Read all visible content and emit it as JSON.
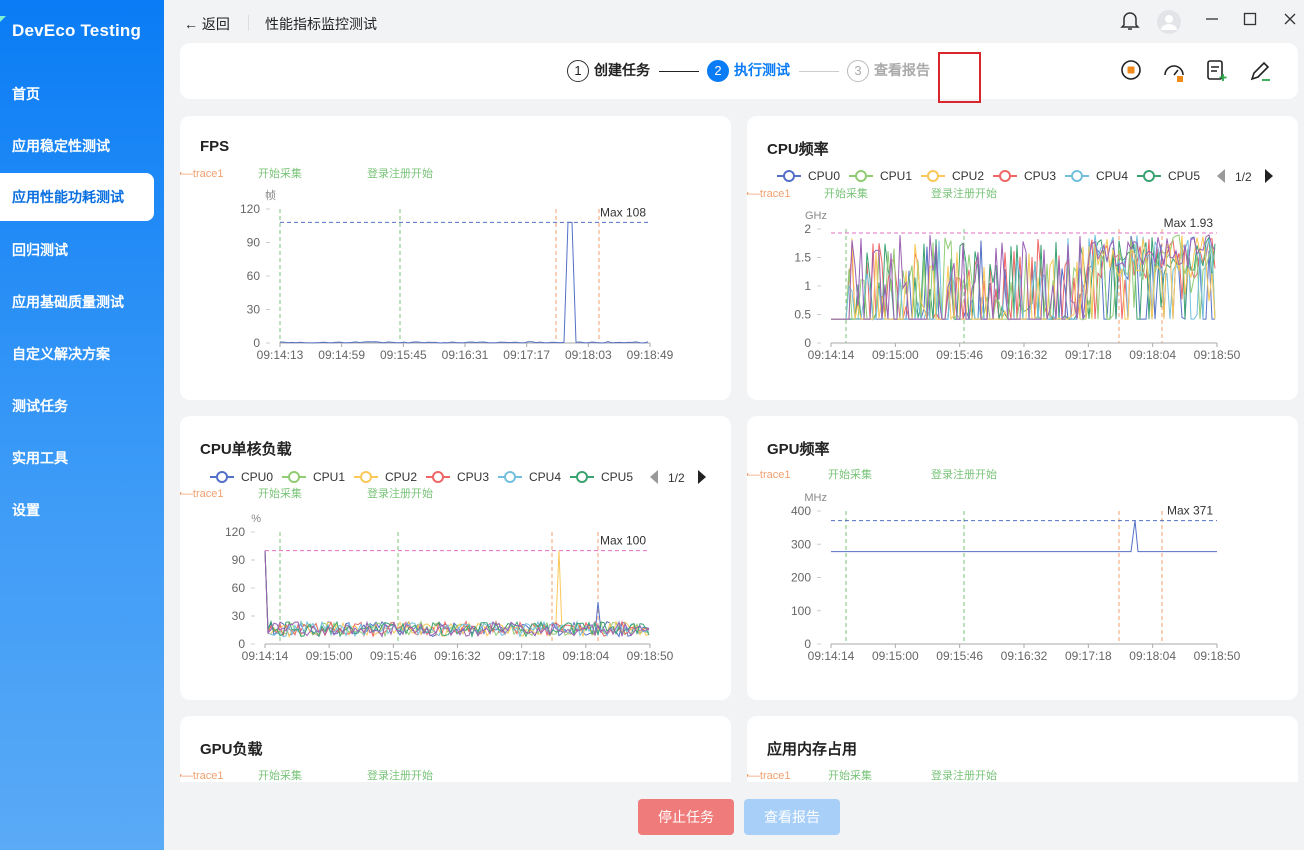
{
  "app": {
    "logo": "DevEco Testing"
  },
  "sidebar": {
    "items": [
      {
        "label": "首页"
      },
      {
        "label": "应用稳定性测试"
      },
      {
        "label": "应用性能功耗测试"
      },
      {
        "label": "回归测试"
      },
      {
        "label": "应用基础质量测试"
      },
      {
        "label": "自定义解决方案"
      },
      {
        "label": "测试任务"
      },
      {
        "label": "实用工具"
      },
      {
        "label": "设置"
      }
    ],
    "active_index": 2
  },
  "header": {
    "back_label": "← 返回",
    "title": "性能指标监控测试"
  },
  "steps": [
    {
      "num": "1",
      "label": "创建任务"
    },
    {
      "num": "2",
      "label": "执行测试"
    },
    {
      "num": "3",
      "label": "查看报告"
    }
  ],
  "toolbar": {
    "icons": [
      "record-stop-icon",
      "gauge-icon",
      "add-note-icon",
      "edit-pen-icon"
    ]
  },
  "buttons": {
    "stop": "停止任务",
    "report": "查看报告"
  },
  "markers": {
    "start": "开始采集",
    "login": "登录注册开始",
    "trace": "trace1—•—trace1"
  },
  "colors": {
    "accent": "#0a7cf5",
    "stop": "#f07b7b",
    "report_disabled": "#a8cff8",
    "cpu": [
      "#5470c6",
      "#91cc75",
      "#fac858",
      "#ee6666",
      "#73c0de",
      "#3ba272"
    ]
  },
  "legend": {
    "cpu": [
      "CPU0",
      "CPU1",
      "CPU2",
      "CPU3",
      "CPU4",
      "CPU5"
    ],
    "page": "1/2"
  },
  "chart_data": [
    {
      "type": "line",
      "title": "FPS",
      "ylabel": "帧",
      "ylim": [
        0,
        120
      ],
      "yticks": [
        0,
        30,
        60,
        90,
        120
      ],
      "x": [
        "09:14:13",
        "09:14:59",
        "09:15:45",
        "09:16:31",
        "09:17:17",
        "09:18:03",
        "09:18:49"
      ],
      "max_label": "Max 108",
      "series": [
        {
          "values": [
            0,
            1,
            0,
            1,
            0,
            0,
            108,
            2,
            1
          ]
        }
      ]
    },
    {
      "type": "line",
      "title": "CPU频率",
      "ylabel": "GHz",
      "ylim": [
        0,
        2
      ],
      "yticks": [
        "0",
        "0.5",
        "1",
        "1.5",
        "2"
      ],
      "x": [
        "09:14:14",
        "09:15:00",
        "09:15:46",
        "09:16:32",
        "09:17:18",
        "09:18:04",
        "09:18:50"
      ],
      "max_label": "Max 1.93",
      "legend": [
        "CPU0",
        "CPU1",
        "CPU2",
        "CPU3",
        "CPU4",
        "CPU5"
      ]
    },
    {
      "type": "line",
      "title": "CPU单核负载",
      "ylabel": "%",
      "ylim": [
        0,
        120
      ],
      "yticks": [
        0,
        30,
        60,
        90,
        120
      ],
      "x": [
        "09:14:14",
        "09:15:00",
        "09:15:46",
        "09:16:32",
        "09:17:18",
        "09:18:04",
        "09:18:50"
      ],
      "max_label": "Max 100",
      "legend": [
        "CPU0",
        "CPU1",
        "CPU2",
        "CPU3",
        "CPU4",
        "CPU5"
      ]
    },
    {
      "type": "line",
      "title": "GPU频率",
      "ylabel": "MHz",
      "ylim": [
        0,
        400
      ],
      "yticks": [
        0,
        100,
        200,
        300,
        400
      ],
      "x": [
        "09:14:14",
        "09:15:00",
        "09:15:46",
        "09:16:32",
        "09:17:18",
        "09:18:04",
        "09:18:50"
      ],
      "max_label": "Max 371",
      "series": [
        {
          "values": [
            278,
            278,
            278,
            278,
            278,
            371,
            278,
            278
          ]
        }
      ]
    },
    {
      "type": "line",
      "title": "GPU负载"
    },
    {
      "type": "line",
      "title": "应用内存占用"
    }
  ]
}
